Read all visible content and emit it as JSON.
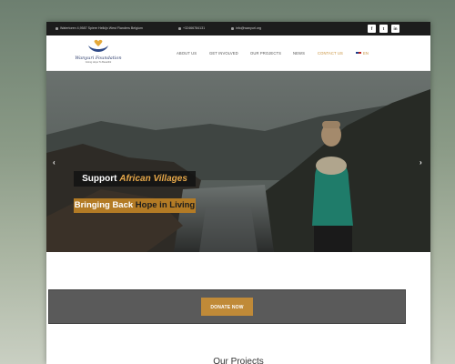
{
  "topbar": {
    "address": "Watertoren 4,9587 Spiere Helkijn West Flanders Belgium",
    "phone": "+32466784131",
    "email": "info@wanyuri.org",
    "social": [
      "f",
      "t",
      "in"
    ]
  },
  "brand": {
    "name": "Wanyuri Foundation",
    "tagline": "Giving Hope To Beautiful"
  },
  "nav": {
    "items": [
      "ABOUT US",
      "GET INVOLVED",
      "OUR PROJECTS",
      "NEWS",
      "CONTACT US"
    ],
    "language": "EN"
  },
  "hero": {
    "line1_pre": "Support ",
    "line1_hl": "African Villages",
    "line2_pre": "Bringing Back ",
    "line2_hl": "Hope in Living",
    "prev": "‹",
    "next": "›"
  },
  "donate": {
    "button": "DONATE NOW"
  },
  "projects": {
    "title": "Our Projects"
  },
  "colors": {
    "accent": "#c08a38",
    "topbar": "#1c1c1c",
    "donate_box": "#5a5a5a"
  },
  "icons": [
    "location-icon",
    "phone-icon",
    "mail-icon",
    "facebook-icon",
    "twitter-icon",
    "linkedin-icon",
    "flag-us-icon"
  ]
}
